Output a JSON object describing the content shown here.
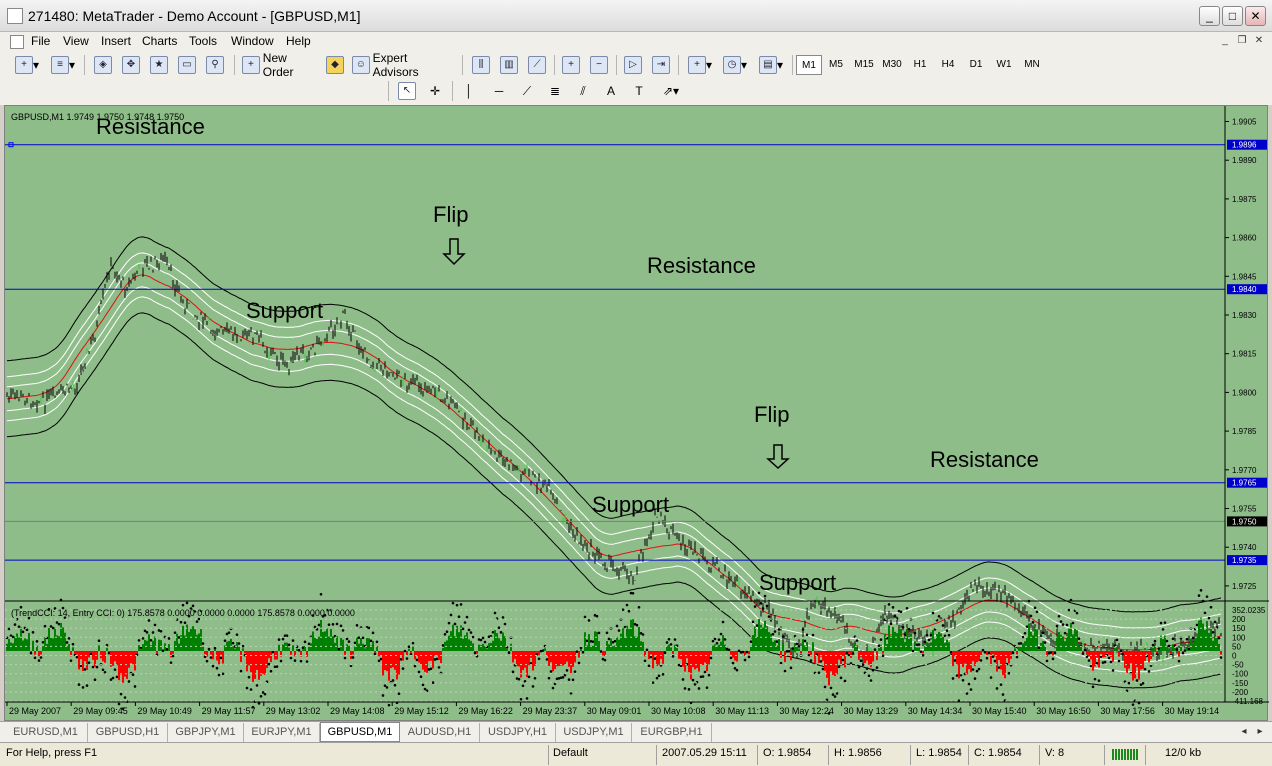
{
  "window": {
    "title": "271480: MetaTrader - Demo Account - [GBPUSD,M1]"
  },
  "menu": [
    "File",
    "View",
    "Insert",
    "Charts",
    "Tools",
    "Window",
    "Help"
  ],
  "toolbar": {
    "new_order": "New Order",
    "expert_advisors": "Expert Advisors"
  },
  "timeframes": [
    "M1",
    "M5",
    "M15",
    "M30",
    "H1",
    "H4",
    "D1",
    "W1",
    "MN"
  ],
  "active_timeframe": "M1",
  "drawing_tools": [
    "cursor-icon",
    "crosshair-icon",
    "vertical-line-icon",
    "horizontal-line-icon",
    "trendline-icon",
    "fibonacci-icon",
    "text-icon",
    "text-label-icon",
    "arrows-icon"
  ],
  "chart_header": {
    "info": "GBPUSD,M1  1.9749 1.9750 1.9748 1.9750"
  },
  "annotations": {
    "resistance_1": "Resistance",
    "flip_1": "Flip",
    "support_1": "Support",
    "resistance_2": "Resistance",
    "support_2": "Support",
    "flip_2": "Flip",
    "resistance_3": "Resistance",
    "support_3": "Support"
  },
  "price_axis": {
    "ticks": [
      "1.9905",
      "1.9890",
      "1.9875",
      "1.9860",
      "1.9845",
      "1.9830",
      "1.9815",
      "1.9800",
      "1.9785",
      "1.9770",
      "1.9755",
      "1.9740",
      "1.9725"
    ],
    "markers": {
      "line_1": "1.9896",
      "line_2": "1.9840",
      "line_3": "1.9765",
      "current": "1.9750",
      "line_4": "1.9735"
    }
  },
  "indicator": {
    "header": "(TrendCCI: 14, Entry CCI: 0)  175.8578 0.0000 0.0000 0.0000 175.8578 0.0000 0.0000",
    "ticks": [
      "352.0235",
      "200",
      "150",
      "100",
      "50",
      "0",
      "-50",
      "-100",
      "-150",
      "-200",
      "-411.168"
    ]
  },
  "time_axis": [
    "29 May 2007",
    "29 May 09:45",
    "29 May 10:49",
    "29 May 11:57",
    "29 May 13:02",
    "29 May 14:08",
    "29 May 15:12",
    "29 May 16:22",
    "29 May 23:37",
    "30 May 09:01",
    "30 May 10:08",
    "30 May 11:13",
    "30 May 12:24",
    "30 May 13:29",
    "30 May 14:34",
    "30 May 15:40",
    "30 May 16:50",
    "30 May 17:56",
    "30 May 19:14"
  ],
  "tabs": [
    "EURUSD,M1",
    "GBPUSD,H1",
    "GBPJPY,M1",
    "EURJPY,M1",
    "GBPUSD,M1",
    "AUDUSD,H1",
    "USDJPY,H1",
    "USDJPY,M1",
    "EURGBP,H1"
  ],
  "active_tab": "GBPUSD,M1",
  "status": {
    "help": "For Help, press F1",
    "profile": "Default",
    "datetime": "2007.05.29 15:11",
    "open": "O: 1.9854",
    "high": "H: 1.9856",
    "low": "L: 1.9854",
    "close": "C: 1.9854",
    "volume": "V: 8",
    "traffic": "12/0 kb"
  },
  "colors": {
    "chart_bg": "#8fbd8a",
    "price_line": "#0000cc",
    "ma_center": "#e01010",
    "band_inner": "#ffffff",
    "band_outer": "#000000",
    "cci_up": "#008000",
    "cci_down": "#ff0000"
  }
}
